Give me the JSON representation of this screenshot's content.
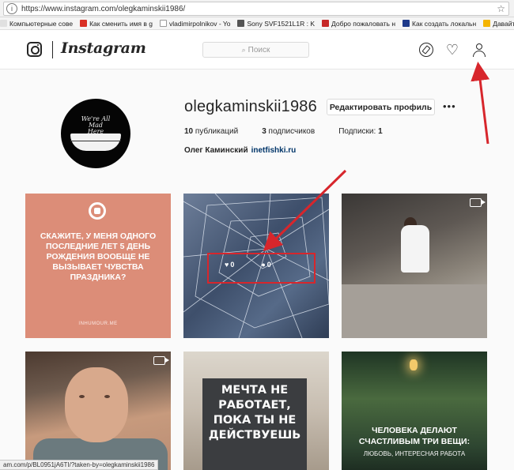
{
  "browser": {
    "url": "https://www.instagram.com/olegkaminskii1986/",
    "bookmarks": [
      {
        "label": "Компьютерные сове",
        "color": "#e8e8e8"
      },
      {
        "label": "Как сменить имя в g",
        "color": "#d93025"
      },
      {
        "label": "vladimirpolnikov - Yo",
        "color": "#ffffff"
      },
      {
        "label": "Sony SVF1521L1R : K",
        "color": "#555555"
      },
      {
        "label": "Добро пожаловать н",
        "color": "#c62828"
      },
      {
        "label": "Как создать локальн",
        "color": "#1e3a8a"
      },
      {
        "label": "Давайте знакомить",
        "color": "#f4b400"
      }
    ],
    "status_text": "am.com/p/BL0951jA6TI/?taken-by=olegkaminskii1986"
  },
  "header": {
    "logo_text": "Instagram",
    "search_placeholder": "Поиск",
    "icons": [
      "explore-compass-icon",
      "activity-heart-icon",
      "profile-person-icon"
    ]
  },
  "profile": {
    "username": "olegkaminskii1986",
    "edit_button": "Редактировать профиль",
    "more_label": "•••",
    "avatar_text": "We're All Mad Here",
    "stats": {
      "posts_count": "10",
      "posts_label": "публикаций",
      "followers_count": "3",
      "followers_label": "подписчиков",
      "following_label": "Подписки:",
      "following_count": "1"
    },
    "full_name": "Олег Каминский",
    "website": "inetfishki.ru"
  },
  "posts": [
    {
      "text": "СКАЖИТЕ, У МЕНЯ ОДНОГО ПОСЛЕДНИЕ ЛЕТ 5 ДЕНЬ РОЖДЕНИЯ ВООБЩЕ НЕ ВЫЗЫВАЕТ ЧУВСТВА ПРАЗДНИКА?",
      "footer": "INHUMOUR.ME"
    },
    {
      "likes": "0",
      "comments": "0"
    },
    {
      "type_icon": "video-icon"
    },
    {
      "type_icon": "video-icon"
    },
    {
      "text": "МЕЧТА НЕ РАБОТАЕТ, ПОКА ТЫ НЕ ДЕЙСТВУЕШЬ"
    },
    {
      "text": "ЧЕЛОВЕКА ДЕЛАЮТ СЧАСТЛИВЫМ ТРИ ВЕЩИ:",
      "subtext": "ЛЮБОВЬ, ИНТЕРЕСНАЯ РАБОТА"
    }
  ],
  "annotation": {
    "color": "#d7262c"
  }
}
